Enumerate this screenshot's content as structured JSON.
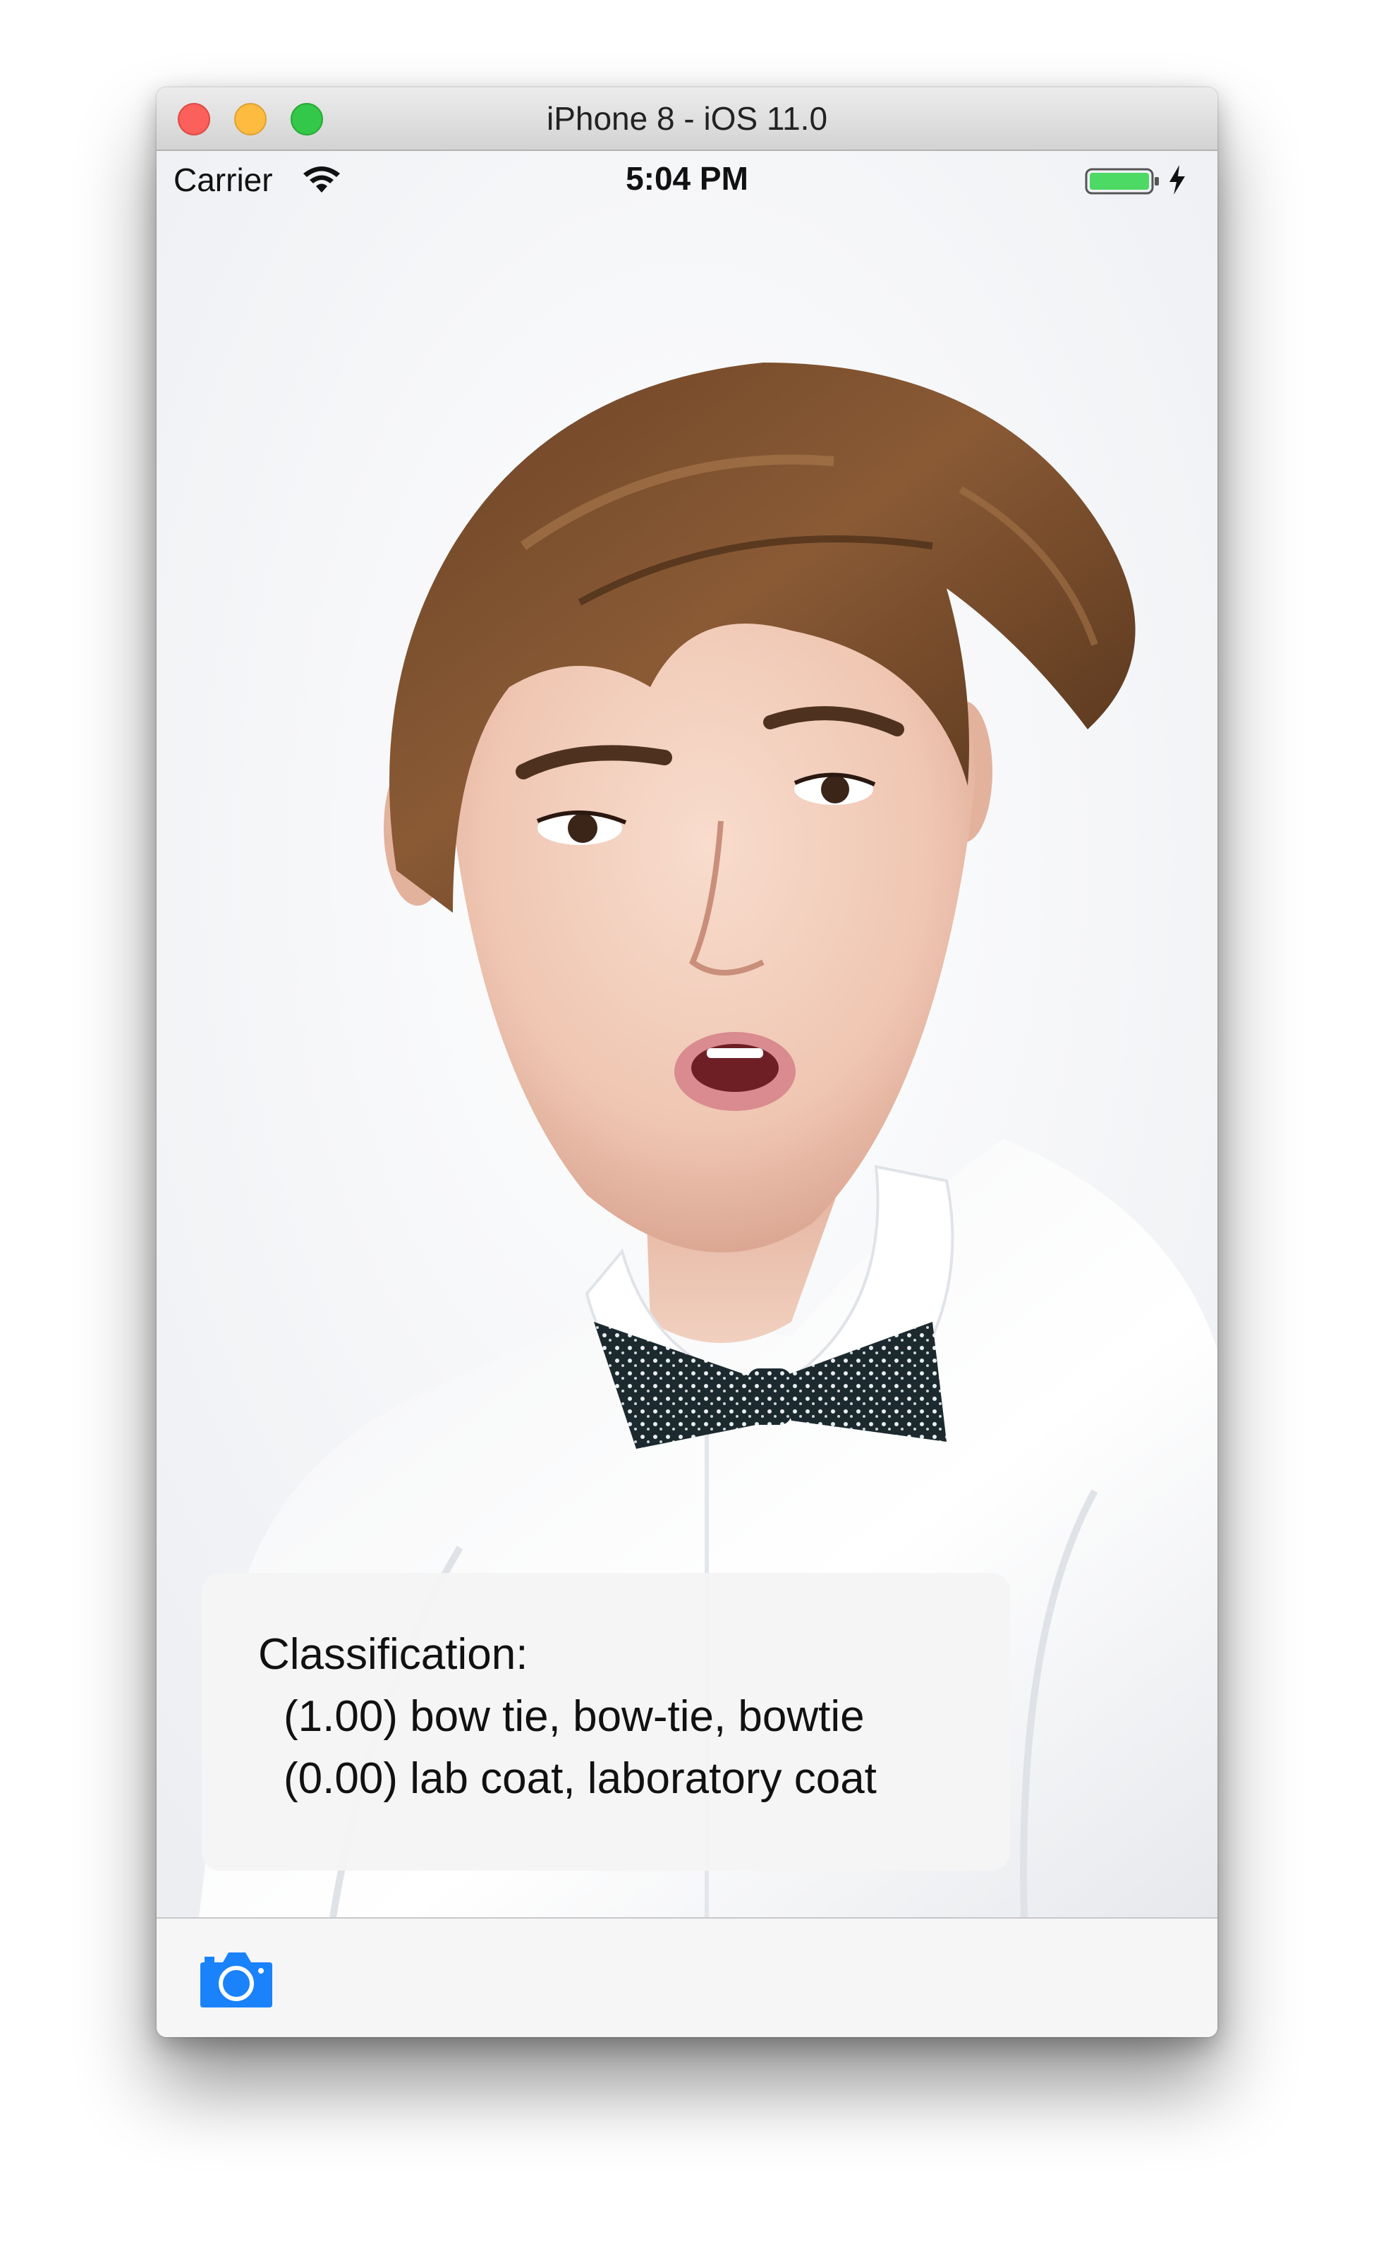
{
  "window": {
    "title": "iPhone 8 - iOS 11.0",
    "controls": {
      "close_color": "#fc605b",
      "minimize_color": "#fdbc40",
      "zoom_color": "#34c84a"
    }
  },
  "status_bar": {
    "carrier": "Carrier",
    "time": "5:04 PM",
    "wifi_icon": "wifi-icon",
    "battery_icon": "battery-icon",
    "charging_icon": "charging-bolt-icon",
    "battery_color": "#4cd964"
  },
  "photo": {
    "subject": "portrait photo"
  },
  "classification": {
    "title": "Classification:",
    "results": [
      "(1.00) bow tie, bow-tie, bowtie",
      "(0.00) lab coat, laboratory coat"
    ]
  },
  "toolbar": {
    "camera_icon": "camera-icon",
    "accent": "#1a82fb"
  }
}
